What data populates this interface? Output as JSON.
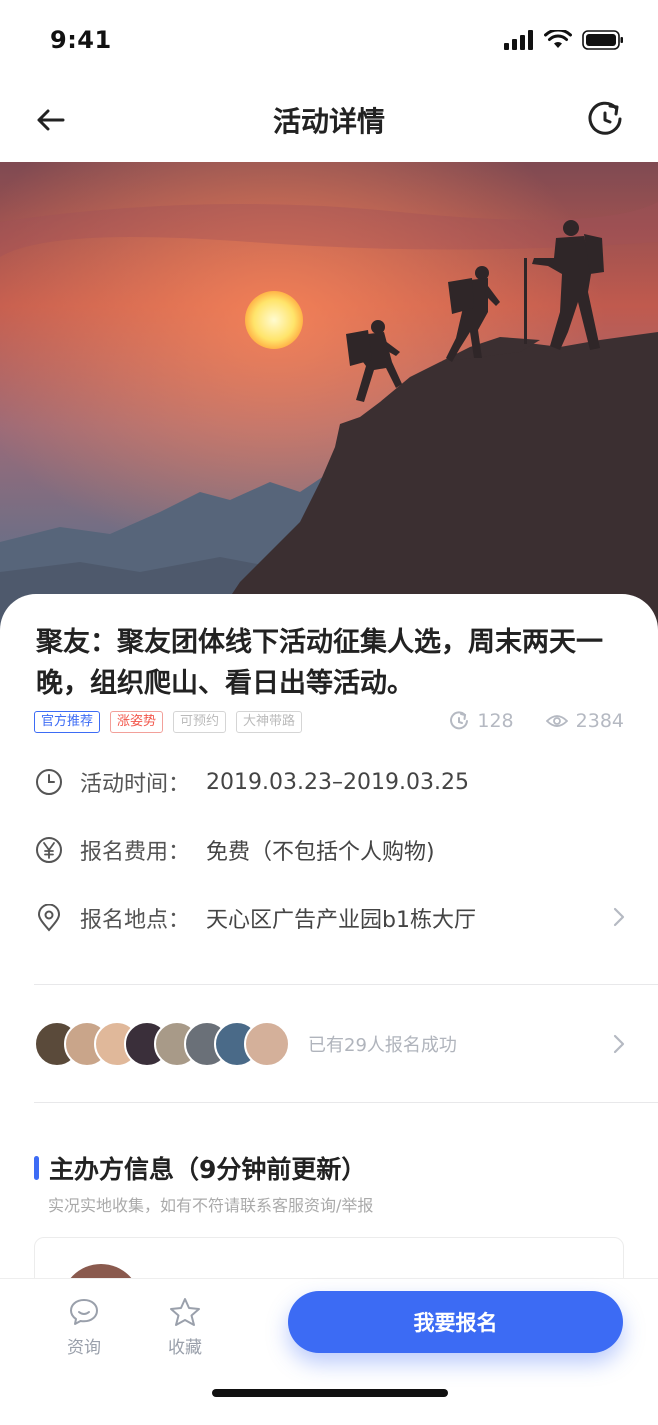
{
  "status_bar": {
    "time": "9:41"
  },
  "nav": {
    "title": "活动详情",
    "back_icon": "arrow-left-icon",
    "share_icon": "refresh-share-icon"
  },
  "hero": {
    "alt_subject": "silhouette-hikers-sunset"
  },
  "event": {
    "title": "聚友：聚友团体线下活动征集人选，周末两天一晚，组织爬山、看日出等活动。",
    "tags": [
      {
        "label": "官方推荐",
        "style": "blue"
      },
      {
        "label": "涨姿势",
        "style": "red"
      },
      {
        "label": "可预约",
        "style": "gray"
      },
      {
        "label": "大神带路",
        "style": "gray"
      }
    ],
    "share_count": "128",
    "view_count": "2384",
    "time_label": "活动时间：",
    "time_value": "2019.03.23–2019.03.25",
    "fee_label": "报名费用：",
    "fee_value": "免费（不包括个人购物)",
    "location_label": "报名地点：",
    "location_value": "天心区广告产业园b1栋大厅"
  },
  "signup": {
    "text": "已有29人报名成功",
    "avatar_colors": [
      "#5a4a3a",
      "#c9a58a",
      "#e0b89a",
      "#3a2f3a",
      "#a89a88",
      "#6a7078",
      "#4a6a88",
      "#d4b09a"
    ]
  },
  "organizer": {
    "section_title": "主办方信息（9分钟前更新）",
    "section_sub": "实况实地收集，如有不符请联系客服资询/举报"
  },
  "bottom_bar": {
    "consult_label": "资询",
    "favorite_label": "收藏",
    "cta_label": "我要报名"
  },
  "colors": {
    "accent": "#3c6bf4",
    "tag_red": "#f2574b"
  }
}
